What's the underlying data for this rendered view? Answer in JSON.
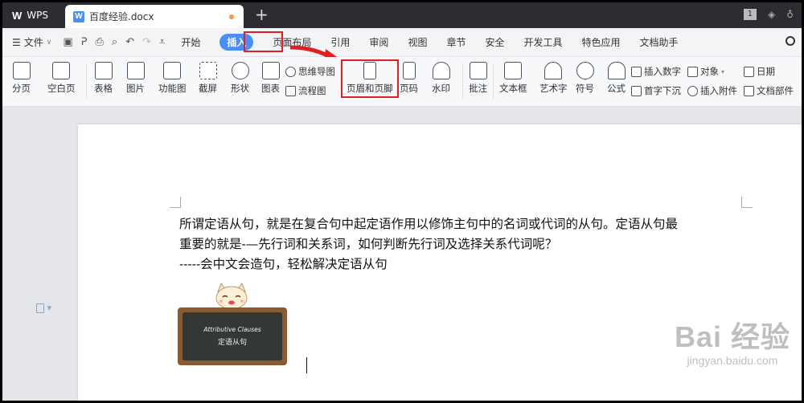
{
  "titlebar": {
    "app_name": "WPS",
    "doc_tab_name": "百度经验.docx",
    "page_badge": "1"
  },
  "menu": {
    "file_label": "文件",
    "tabs": [
      "开始",
      "插入",
      "页面布局",
      "引用",
      "审阅",
      "视图",
      "章节",
      "安全",
      "开发工具",
      "特色应用",
      "文档助手"
    ],
    "active_tab": "插入"
  },
  "ribbon": {
    "items": [
      {
        "label": "分页",
        "icon": "page-break-icon"
      },
      {
        "label": "空白页",
        "icon": "blank-page-icon"
      },
      {
        "label": "表格",
        "icon": "table-icon"
      },
      {
        "label": "图片",
        "icon": "picture-icon"
      },
      {
        "label": "功能图",
        "icon": "function-chart-icon"
      },
      {
        "label": "截屏",
        "icon": "screenshot-icon"
      },
      {
        "label": "形状",
        "icon": "shapes-icon"
      },
      {
        "label": "图表",
        "icon": "chart-icon"
      },
      {
        "label": "思维导图",
        "icon": "mindmap-icon"
      },
      {
        "label": "流程图",
        "icon": "flowchart-icon"
      },
      {
        "label": "页眉和页脚",
        "icon": "header-footer-icon"
      },
      {
        "label": "页码",
        "icon": "page-number-icon"
      },
      {
        "label": "水印",
        "icon": "watermark-icon"
      },
      {
        "label": "批注",
        "icon": "comment-icon"
      },
      {
        "label": "文本框",
        "icon": "textbox-icon"
      },
      {
        "label": "艺术字",
        "icon": "wordart-icon"
      },
      {
        "label": "符号",
        "icon": "symbol-icon"
      },
      {
        "label": "公式",
        "icon": "formula-icon"
      },
      {
        "label": "插入数字",
        "icon": "insert-number-icon"
      },
      {
        "label": "首字下沉",
        "icon": "drop-cap-icon"
      },
      {
        "label": "对象",
        "icon": "object-icon"
      },
      {
        "label": "插入附件",
        "icon": "attachment-icon"
      },
      {
        "label": "日期",
        "icon": "date-icon"
      },
      {
        "label": "文档部件",
        "icon": "doc-parts-icon"
      }
    ]
  },
  "document": {
    "paragraph1_line1": "所谓定语从句，就是在复合句中起定语作用以修饰主句中的名词或代词的从句。定语从句最",
    "paragraph1_line2": "重要的就是-—先行词和关系词，如何判断先行词及选择关系代词呢？",
    "paragraph2": "-----会中文会造句，轻松解决定语从句",
    "image_title_en": "Attributive Clauses",
    "image_title_cn": "定语从句"
  },
  "watermark": {
    "big": "Bai  经验",
    "small": "jingyan.baidu.com"
  },
  "colors": {
    "titlebar_bg": "#2b2d33",
    "accent_blue": "#4a8ef7",
    "highlight_red": "#e02020"
  }
}
